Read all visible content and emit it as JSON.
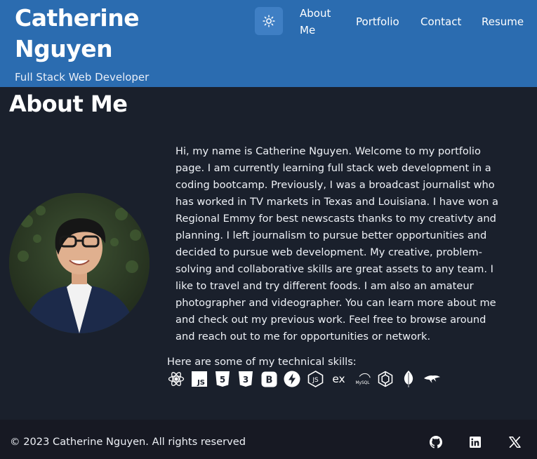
{
  "header": {
    "name_line1": "Catherine",
    "name_line2": "Nguyen",
    "subtitle": "Full Stack Web Developer",
    "theme_toggle_icon": "sun-icon",
    "nav": {
      "about": "About Me",
      "portfolio": "Portfolio",
      "contact": "Contact",
      "resume": "Resume"
    }
  },
  "main": {
    "title": "About Me",
    "avatar_alt": "Catherine Nguyen",
    "bio": "Hi, my name is Catherine Nguyen. Welcome to my portfolio page. I am currently learning full stack web development in a coding bootcamp. Previously, I was a broadcast journalist who has worked in TV markets in Texas and Louisiana. I have won a Regional Emmy for best newscasts thanks to my creativty and planning. I left journalism to pursue better opportunities and decided to pursue web development. My creative, problem-solving and collaborative skills are great assets to any team. I like to travel and try different foods. I am also an amateur photographer and videographer. You can learn more about me and check out my previous work. Feel free to browse around and reach out to me for opportunities or network.",
    "skills_label": "Here are some of my technical skills:",
    "skills": [
      {
        "icon": "react-icon",
        "label": ""
      },
      {
        "icon": "javascript-icon",
        "label": "JS"
      },
      {
        "icon": "html5-icon",
        "label": "5"
      },
      {
        "icon": "css3-icon",
        "label": "3"
      },
      {
        "icon": "bootstrap-icon",
        "label": "B"
      },
      {
        "icon": "lightning-icon",
        "label": ""
      },
      {
        "icon": "nodejs-icon",
        "label": "JS"
      },
      {
        "icon": "express-icon",
        "label": "ex"
      },
      {
        "icon": "mysql-icon",
        "label": "MySQL"
      },
      {
        "icon": "graphql-icon",
        "label": ""
      },
      {
        "icon": "mongodb-icon",
        "label": ""
      },
      {
        "icon": "sequelize-icon",
        "label": ""
      }
    ]
  },
  "footer": {
    "copyright": "© 2023 Catherine Nguyen. All rights reserved",
    "social": [
      "github-icon",
      "linkedin-icon",
      "x-icon"
    ]
  },
  "colors": {
    "header_bg": "#2b6cb0",
    "page_bg": "#1a202c",
    "footer_bg": "#171923",
    "text": "#ffffff"
  }
}
